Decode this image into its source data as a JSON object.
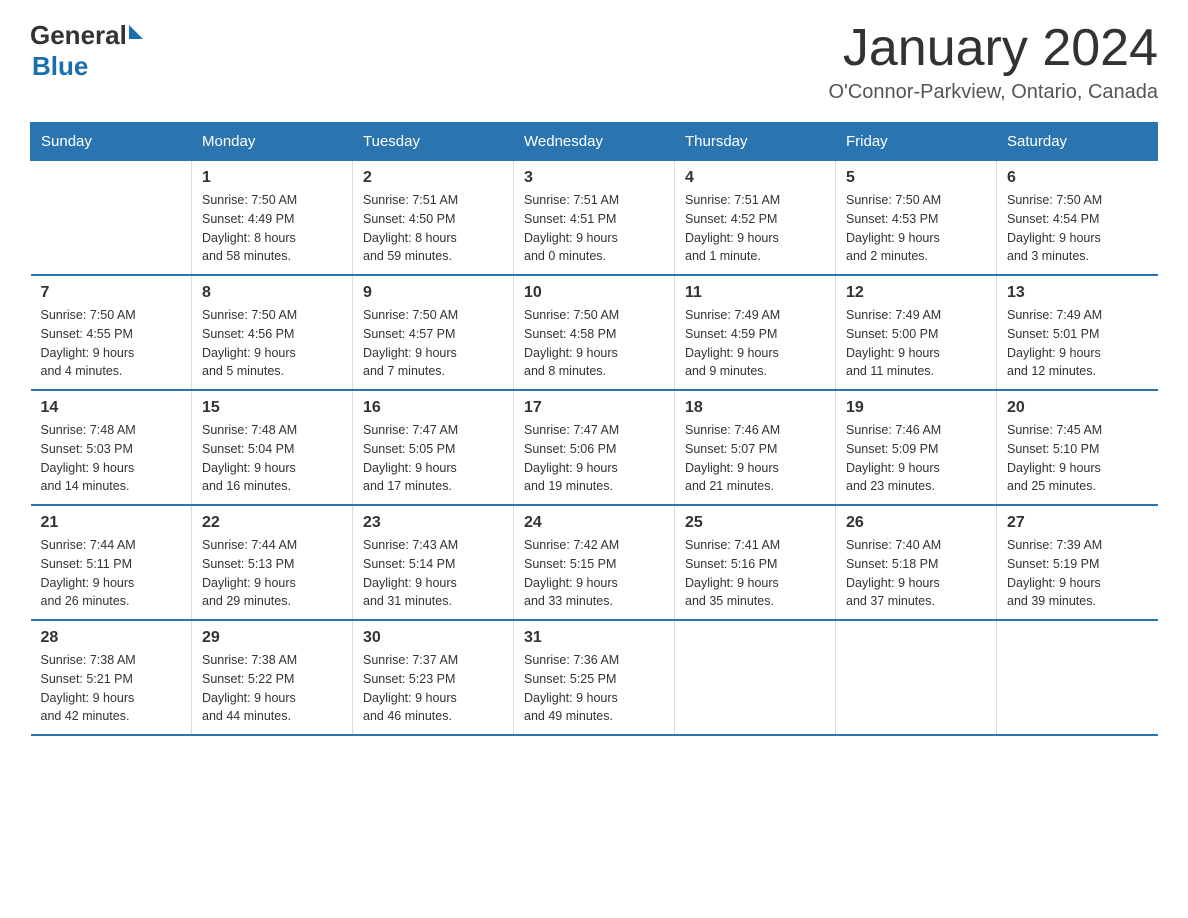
{
  "header": {
    "logo_general": "General",
    "logo_blue": "Blue",
    "month_title": "January 2024",
    "location": "O'Connor-Parkview, Ontario, Canada"
  },
  "days_of_week": [
    "Sunday",
    "Monday",
    "Tuesday",
    "Wednesday",
    "Thursday",
    "Friday",
    "Saturday"
  ],
  "weeks": [
    [
      {
        "day": "",
        "info": ""
      },
      {
        "day": "1",
        "info": "Sunrise: 7:50 AM\nSunset: 4:49 PM\nDaylight: 8 hours\nand 58 minutes."
      },
      {
        "day": "2",
        "info": "Sunrise: 7:51 AM\nSunset: 4:50 PM\nDaylight: 8 hours\nand 59 minutes."
      },
      {
        "day": "3",
        "info": "Sunrise: 7:51 AM\nSunset: 4:51 PM\nDaylight: 9 hours\nand 0 minutes."
      },
      {
        "day": "4",
        "info": "Sunrise: 7:51 AM\nSunset: 4:52 PM\nDaylight: 9 hours\nand 1 minute."
      },
      {
        "day": "5",
        "info": "Sunrise: 7:50 AM\nSunset: 4:53 PM\nDaylight: 9 hours\nand 2 minutes."
      },
      {
        "day": "6",
        "info": "Sunrise: 7:50 AM\nSunset: 4:54 PM\nDaylight: 9 hours\nand 3 minutes."
      }
    ],
    [
      {
        "day": "7",
        "info": "Sunrise: 7:50 AM\nSunset: 4:55 PM\nDaylight: 9 hours\nand 4 minutes."
      },
      {
        "day": "8",
        "info": "Sunrise: 7:50 AM\nSunset: 4:56 PM\nDaylight: 9 hours\nand 5 minutes."
      },
      {
        "day": "9",
        "info": "Sunrise: 7:50 AM\nSunset: 4:57 PM\nDaylight: 9 hours\nand 7 minutes."
      },
      {
        "day": "10",
        "info": "Sunrise: 7:50 AM\nSunset: 4:58 PM\nDaylight: 9 hours\nand 8 minutes."
      },
      {
        "day": "11",
        "info": "Sunrise: 7:49 AM\nSunset: 4:59 PM\nDaylight: 9 hours\nand 9 minutes."
      },
      {
        "day": "12",
        "info": "Sunrise: 7:49 AM\nSunset: 5:00 PM\nDaylight: 9 hours\nand 11 minutes."
      },
      {
        "day": "13",
        "info": "Sunrise: 7:49 AM\nSunset: 5:01 PM\nDaylight: 9 hours\nand 12 minutes."
      }
    ],
    [
      {
        "day": "14",
        "info": "Sunrise: 7:48 AM\nSunset: 5:03 PM\nDaylight: 9 hours\nand 14 minutes."
      },
      {
        "day": "15",
        "info": "Sunrise: 7:48 AM\nSunset: 5:04 PM\nDaylight: 9 hours\nand 16 minutes."
      },
      {
        "day": "16",
        "info": "Sunrise: 7:47 AM\nSunset: 5:05 PM\nDaylight: 9 hours\nand 17 minutes."
      },
      {
        "day": "17",
        "info": "Sunrise: 7:47 AM\nSunset: 5:06 PM\nDaylight: 9 hours\nand 19 minutes."
      },
      {
        "day": "18",
        "info": "Sunrise: 7:46 AM\nSunset: 5:07 PM\nDaylight: 9 hours\nand 21 minutes."
      },
      {
        "day": "19",
        "info": "Sunrise: 7:46 AM\nSunset: 5:09 PM\nDaylight: 9 hours\nand 23 minutes."
      },
      {
        "day": "20",
        "info": "Sunrise: 7:45 AM\nSunset: 5:10 PM\nDaylight: 9 hours\nand 25 minutes."
      }
    ],
    [
      {
        "day": "21",
        "info": "Sunrise: 7:44 AM\nSunset: 5:11 PM\nDaylight: 9 hours\nand 26 minutes."
      },
      {
        "day": "22",
        "info": "Sunrise: 7:44 AM\nSunset: 5:13 PM\nDaylight: 9 hours\nand 29 minutes."
      },
      {
        "day": "23",
        "info": "Sunrise: 7:43 AM\nSunset: 5:14 PM\nDaylight: 9 hours\nand 31 minutes."
      },
      {
        "day": "24",
        "info": "Sunrise: 7:42 AM\nSunset: 5:15 PM\nDaylight: 9 hours\nand 33 minutes."
      },
      {
        "day": "25",
        "info": "Sunrise: 7:41 AM\nSunset: 5:16 PM\nDaylight: 9 hours\nand 35 minutes."
      },
      {
        "day": "26",
        "info": "Sunrise: 7:40 AM\nSunset: 5:18 PM\nDaylight: 9 hours\nand 37 minutes."
      },
      {
        "day": "27",
        "info": "Sunrise: 7:39 AM\nSunset: 5:19 PM\nDaylight: 9 hours\nand 39 minutes."
      }
    ],
    [
      {
        "day": "28",
        "info": "Sunrise: 7:38 AM\nSunset: 5:21 PM\nDaylight: 9 hours\nand 42 minutes."
      },
      {
        "day": "29",
        "info": "Sunrise: 7:38 AM\nSunset: 5:22 PM\nDaylight: 9 hours\nand 44 minutes."
      },
      {
        "day": "30",
        "info": "Sunrise: 7:37 AM\nSunset: 5:23 PM\nDaylight: 9 hours\nand 46 minutes."
      },
      {
        "day": "31",
        "info": "Sunrise: 7:36 AM\nSunset: 5:25 PM\nDaylight: 9 hours\nand 49 minutes."
      },
      {
        "day": "",
        "info": ""
      },
      {
        "day": "",
        "info": ""
      },
      {
        "day": "",
        "info": ""
      }
    ]
  ]
}
